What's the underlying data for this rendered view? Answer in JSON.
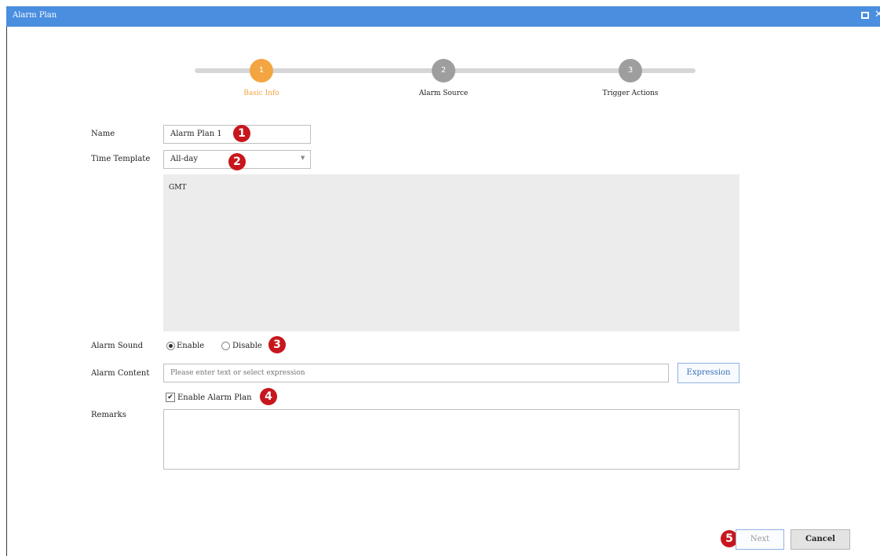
{
  "window": {
    "title": "Alarm Plan",
    "maximize_icon": "maximize-icon",
    "close_icon": "close-icon",
    "close_glyph": "✕"
  },
  "steps": [
    {
      "number": "1",
      "label": "Basic Info",
      "state": "active"
    },
    {
      "number": "2",
      "label": "Alarm Source",
      "state": "inactive"
    },
    {
      "number": "3",
      "label": "Trigger Actions",
      "state": "inactive"
    }
  ],
  "form": {
    "name": {
      "label": "Name",
      "value": "Alarm Plan 1",
      "badge": "1"
    },
    "time_template": {
      "label": "Time Template",
      "value": "All-day",
      "badge": "2",
      "dropdown_icon": "chevron-down-icon",
      "dropdown_glyph": "▼"
    },
    "schedule": {
      "text": "GMT"
    },
    "alarm_sound": {
      "label": "Alarm Sound",
      "options": [
        {
          "label": "Enable",
          "selected": true
        },
        {
          "label": "Disable",
          "selected": false
        }
      ],
      "badge": "3"
    },
    "alarm_content": {
      "label": "Alarm Content",
      "placeholder": "Please enter text or select expression",
      "button_label": "Expression"
    },
    "enable_plan": {
      "label": "Enable Alarm Plan",
      "checked": true,
      "check_glyph": "✔",
      "badge": "4"
    },
    "remarks": {
      "label": "Remarks",
      "value": ""
    }
  },
  "footer": {
    "next_label": "Next",
    "cancel_label": "Cancel",
    "badge": "5"
  },
  "colors": {
    "title_bar": "#4a8ee0",
    "step_active": "#f2a541",
    "step_inactive": "#9e9e9e",
    "badge": "#c8161d",
    "schedule_bg": "#ececec"
  }
}
